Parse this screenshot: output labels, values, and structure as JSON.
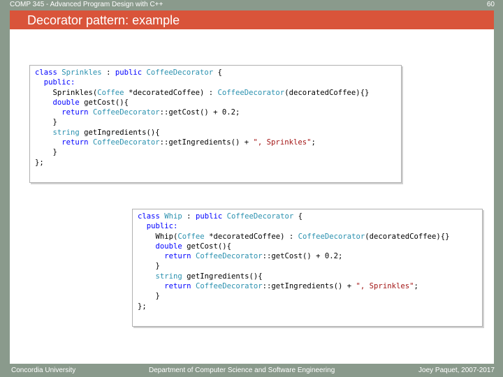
{
  "header": {
    "course": "COMP 345 - Advanced Program Design with C++",
    "page_number": "60"
  },
  "slide": {
    "title": "Decorator pattern: example"
  },
  "code_block_1": {
    "lines": [
      [
        {
          "t": "class ",
          "c": "kw"
        },
        {
          "t": "Sprinkles",
          "c": "ty"
        },
        {
          "t": " : ",
          "c": ""
        },
        {
          "t": "public ",
          "c": "kw"
        },
        {
          "t": "CoffeeDecorator",
          "c": "ty"
        },
        {
          "t": " {",
          "c": ""
        }
      ],
      [
        {
          "t": "  public:",
          "c": "kw"
        }
      ],
      [
        {
          "t": "    Sprinkles(",
          "c": ""
        },
        {
          "t": "Coffee",
          "c": "ty"
        },
        {
          "t": " *decoratedCoffee) : ",
          "c": ""
        },
        {
          "t": "CoffeeDecorator",
          "c": "ty"
        },
        {
          "t": "(decoratedCoffee){}",
          "c": ""
        }
      ],
      [
        {
          "t": "    ",
          "c": ""
        },
        {
          "t": "double ",
          "c": "kw"
        },
        {
          "t": "getCost(){",
          "c": ""
        }
      ],
      [
        {
          "t": "      ",
          "c": ""
        },
        {
          "t": "return ",
          "c": "kw"
        },
        {
          "t": "CoffeeDecorator",
          "c": "ty"
        },
        {
          "t": "::getCost() + 0.2;",
          "c": ""
        }
      ],
      [
        {
          "t": "    }",
          "c": ""
        }
      ],
      [
        {
          "t": "    ",
          "c": ""
        },
        {
          "t": "string ",
          "c": "ty"
        },
        {
          "t": "getIngredients(){",
          "c": ""
        }
      ],
      [
        {
          "t": "      ",
          "c": ""
        },
        {
          "t": "return ",
          "c": "kw"
        },
        {
          "t": "CoffeeDecorator",
          "c": "ty"
        },
        {
          "t": "::getIngredients() + ",
          "c": ""
        },
        {
          "t": "\", Sprinkles\"",
          "c": "str"
        },
        {
          "t": ";",
          "c": ""
        }
      ],
      [
        {
          "t": "    }",
          "c": ""
        }
      ],
      [
        {
          "t": "};",
          "c": ""
        }
      ]
    ]
  },
  "code_block_2": {
    "lines": [
      [
        {
          "t": "class ",
          "c": "kw"
        },
        {
          "t": "Whip",
          "c": "ty"
        },
        {
          "t": " : ",
          "c": ""
        },
        {
          "t": "public ",
          "c": "kw"
        },
        {
          "t": "CoffeeDecorator",
          "c": "ty"
        },
        {
          "t": " {",
          "c": ""
        }
      ],
      [
        {
          "t": "  public:",
          "c": "kw"
        }
      ],
      [
        {
          "t": "    Whip(",
          "c": ""
        },
        {
          "t": "Coffee",
          "c": "ty"
        },
        {
          "t": " *decoratedCoffee) : ",
          "c": ""
        },
        {
          "t": "CoffeeDecorator",
          "c": "ty"
        },
        {
          "t": "(decoratedCoffee){}",
          "c": ""
        }
      ],
      [
        {
          "t": "    ",
          "c": ""
        },
        {
          "t": "double ",
          "c": "kw"
        },
        {
          "t": "getCost(){",
          "c": ""
        }
      ],
      [
        {
          "t": "      ",
          "c": ""
        },
        {
          "t": "return ",
          "c": "kw"
        },
        {
          "t": "CoffeeDecorator",
          "c": "ty"
        },
        {
          "t": "::getCost() + 0.2;",
          "c": ""
        }
      ],
      [
        {
          "t": "    }",
          "c": ""
        }
      ],
      [
        {
          "t": "    ",
          "c": ""
        },
        {
          "t": "string ",
          "c": "ty"
        },
        {
          "t": "getIngredients(){",
          "c": ""
        }
      ],
      [
        {
          "t": "      ",
          "c": ""
        },
        {
          "t": "return ",
          "c": "kw"
        },
        {
          "t": "CoffeeDecorator",
          "c": "ty"
        },
        {
          "t": "::getIngredients() + ",
          "c": ""
        },
        {
          "t": "\", Sprinkles\"",
          "c": "str"
        },
        {
          "t": ";",
          "c": ""
        }
      ],
      [
        {
          "t": "    }",
          "c": ""
        }
      ],
      [
        {
          "t": "};",
          "c": ""
        }
      ]
    ]
  },
  "footer": {
    "left": "Concordia University",
    "center": "Department of Computer Science and Software Engineering",
    "right": "Joey Paquet, 2007-2017"
  }
}
